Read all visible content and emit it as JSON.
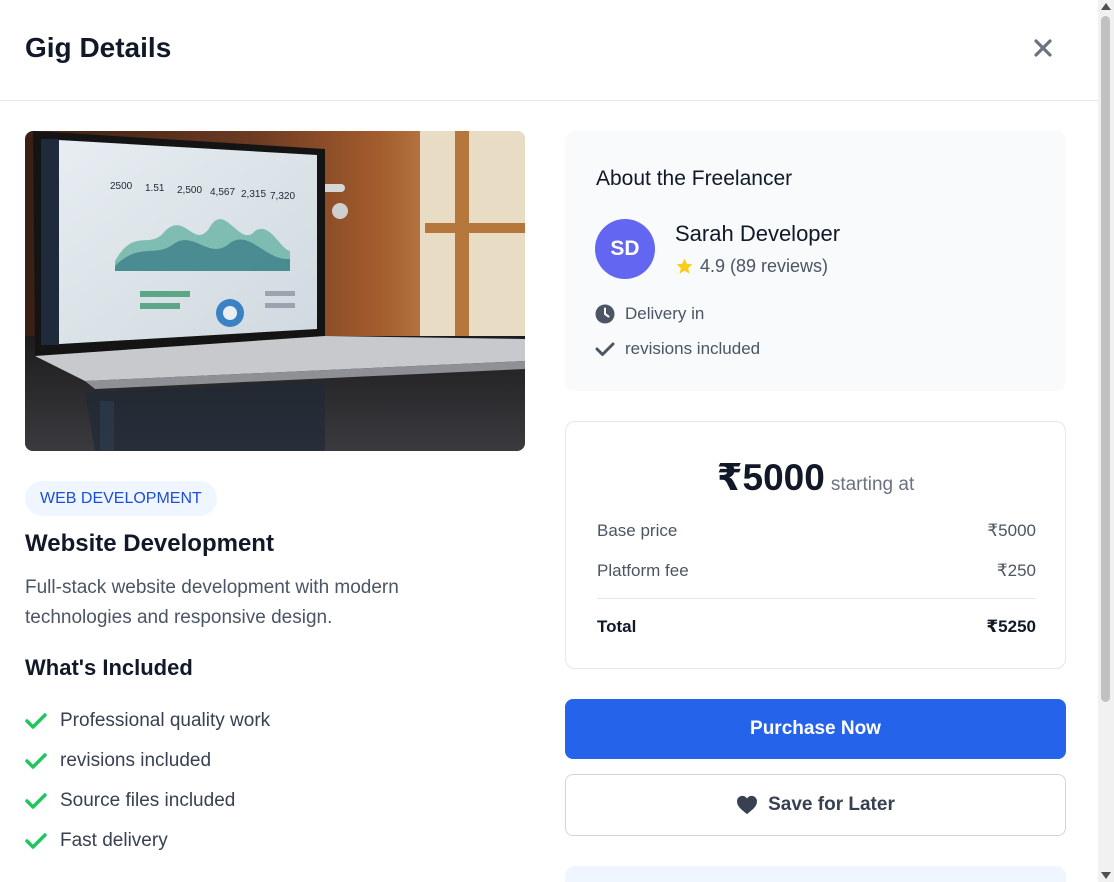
{
  "header": {
    "title": "Gig Details",
    "close_icon": "close-icon"
  },
  "gig": {
    "category": "WEB DEVELOPMENT",
    "title": "Website Development",
    "description": "Full-stack website development with modern technologies and responsive design.",
    "included_title": "What's Included",
    "included": [
      "Professional quality work",
      "revisions included",
      "Source files included",
      "Fast delivery"
    ]
  },
  "freelancer": {
    "section_title": "About the Freelancer",
    "initials": "SD",
    "name": "Sarah Developer",
    "rating": "4.9 (89 reviews)",
    "delivery": "Delivery in",
    "revisions": "revisions included"
  },
  "pricing": {
    "price": "₹5000",
    "price_suffix": "starting at",
    "rows": [
      {
        "label": "Base price",
        "value": "₹5000"
      },
      {
        "label": "Platform fee",
        "value": "₹250"
      }
    ],
    "total_label": "Total",
    "total_value": "₹5250"
  },
  "actions": {
    "purchase": "Purchase Now",
    "save": "Save for Later"
  },
  "colors": {
    "primary": "#2563eb",
    "avatar": "#6366f1",
    "check": "#22c55e",
    "star": "#facc15"
  }
}
